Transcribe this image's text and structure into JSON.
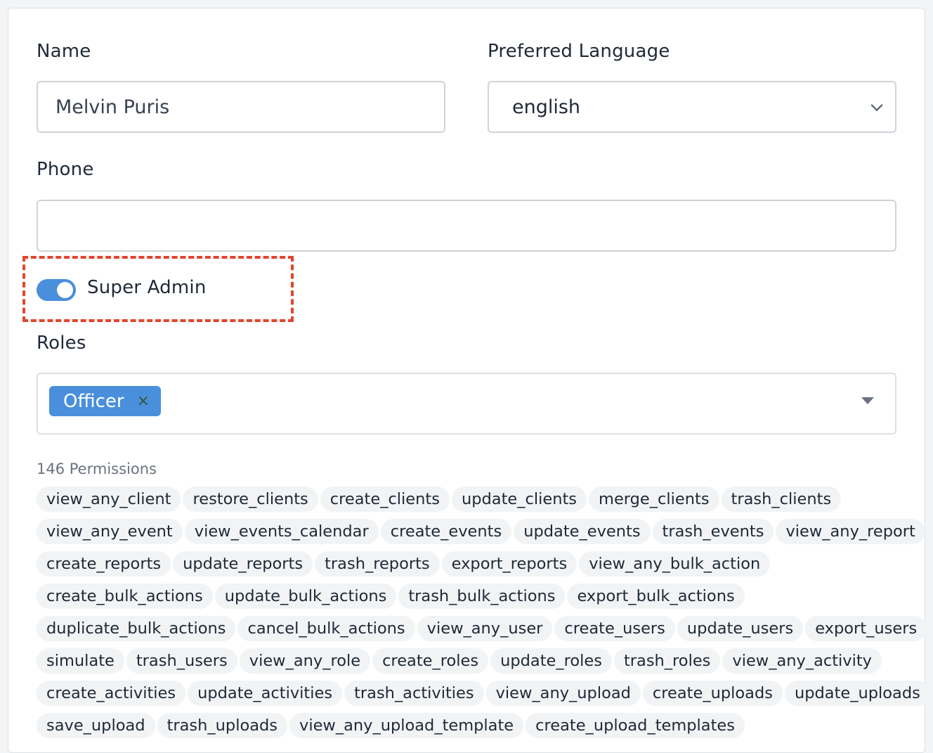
{
  "form": {
    "name_label": "Name",
    "name_value": "Melvin Puris",
    "language_label": "Preferred Language",
    "language_value": "english",
    "phone_label": "Phone",
    "phone_value": "",
    "super_admin_label": "Super Admin",
    "super_admin_on": true,
    "roles_label": "Roles",
    "roles": [
      "Officer"
    ],
    "role_remove_glyph": "×",
    "permissions_count_label": "146 Permissions",
    "permissions": [
      [
        "view_any_client",
        "restore_clients",
        "create_clients",
        "update_clients",
        "merge_clients",
        "trash_clients"
      ],
      [
        "view_any_event",
        "view_events_calendar",
        "create_events",
        "update_events",
        "trash_events",
        "view_any_report"
      ],
      [
        "create_reports",
        "update_reports",
        "trash_reports",
        "export_reports",
        "view_any_bulk_action"
      ],
      [
        "create_bulk_actions",
        "update_bulk_actions",
        "trash_bulk_actions",
        "export_bulk_actions"
      ],
      [
        "duplicate_bulk_actions",
        "cancel_bulk_actions",
        "view_any_user",
        "create_users",
        "update_users",
        "export_users"
      ],
      [
        "simulate",
        "trash_users",
        "view_any_role",
        "create_roles",
        "update_roles",
        "trash_roles",
        "view_any_activity"
      ],
      [
        "create_activities",
        "update_activities",
        "trash_activities",
        "view_any_upload",
        "create_uploads",
        "update_uploads"
      ],
      [
        "save_upload",
        "trash_uploads",
        "view_any_upload_template",
        "create_upload_templates"
      ]
    ]
  },
  "colors": {
    "accent": "#4a8fdc",
    "highlight": "#e2452f",
    "chip_bg": "#f1f3f5"
  }
}
